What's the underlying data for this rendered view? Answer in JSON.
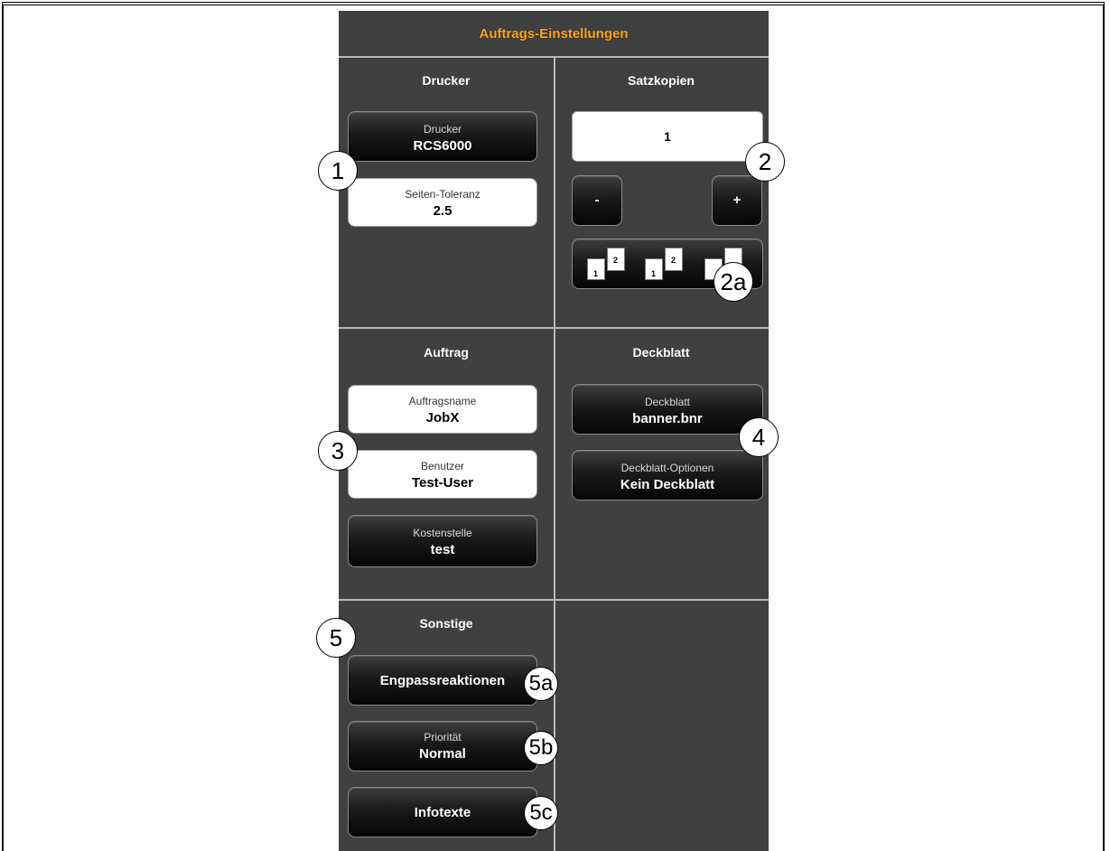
{
  "panel": {
    "title": "Auftrags-Einstellungen"
  },
  "drucker": {
    "section_title": "Drucker",
    "printer_label": "Drucker",
    "printer_value": "RCS6000",
    "tolerance_label": "Seiten-Toleranz",
    "tolerance_value": "2.5"
  },
  "satzkopien": {
    "section_title": "Satzkopien",
    "copies_value": "1",
    "minus_label": "-",
    "plus_label": "+",
    "collate_pages": [
      "1",
      "2",
      "1",
      "2"
    ]
  },
  "auftrag": {
    "section_title": "Auftrag",
    "jobname_label": "Auftragsname",
    "jobname_value": "JobX",
    "user_label": "Benutzer",
    "user_value": "Test-User",
    "cost_label": "Kostenstelle",
    "cost_value": "test"
  },
  "deckblatt": {
    "section_title": "Deckblatt",
    "banner_label": "Deckblatt",
    "banner_value": "banner.bnr",
    "options_label": "Deckblatt-Optionen",
    "options_value": "Kein Deckblatt"
  },
  "sonstige": {
    "section_title": "Sonstige",
    "bottleneck_label": "Engpassreaktionen",
    "priority_label": "Priorität",
    "priority_value": "Normal",
    "infotext_label": "Infotexte"
  },
  "markers": {
    "m1": "1",
    "m2": "2",
    "m2a": "2a",
    "m3": "3",
    "m4": "4",
    "m5": "5",
    "m5a": "5a",
    "m5b": "5b",
    "m5c": "5c"
  }
}
